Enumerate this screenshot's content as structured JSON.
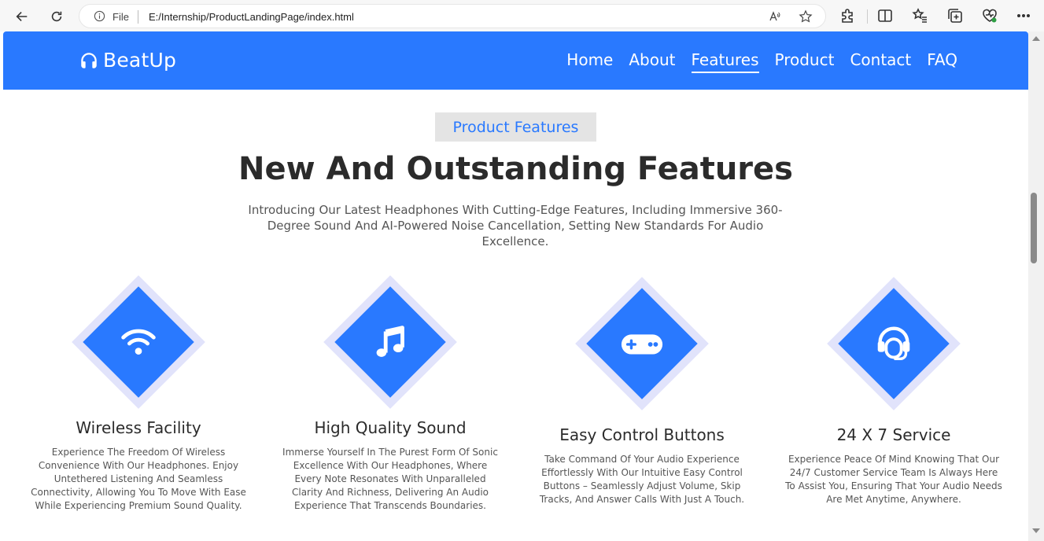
{
  "browser": {
    "file_label": "File",
    "url": "E:/Internship/ProductLandingPage/index.html"
  },
  "site": {
    "brand": "BeatUp",
    "nav": [
      {
        "label": "Home"
      },
      {
        "label": "About"
      },
      {
        "label": "Features",
        "active": true
      },
      {
        "label": "Product"
      },
      {
        "label": "Contact"
      },
      {
        "label": "FAQ"
      }
    ]
  },
  "section": {
    "tag": "Product Features",
    "heading": "New And Outstanding Features",
    "intro": "Introducing Our Latest Headphones With Cutting-Edge Features, Including Immersive 360-Degree Sound And AI-Powered Noise Cancellation, Setting New Standards For Audio Excellence."
  },
  "features": [
    {
      "icon": "wifi-icon",
      "title": "Wireless Facility",
      "text": "Experience The Freedom Of Wireless Convenience With Our Headphones. Enjoy Untethered Listening And Seamless Connectivity, Allowing You To Move With Ease While Experiencing Premium Sound Quality."
    },
    {
      "icon": "music-note-icon",
      "title": "High Quality Sound",
      "text": "Immerse Yourself In The Purest Form Of Sonic Excellence With Our Headphones, Where Every Note Resonates With Unparalleled Clarity And Richness, Delivering An Audio Experience That Transcends Boundaries."
    },
    {
      "icon": "gamepad-icon",
      "title": "Easy Control Buttons",
      "text": "Take Command Of Your Audio Experience Effortlessly With Our Intuitive Easy Control Buttons – Seamlessly Adjust Volume, Skip Tracks, And Answer Calls With Just A Touch."
    },
    {
      "icon": "headset-icon",
      "title": "24 X 7 Service",
      "text": "Experience Peace Of Mind Knowing That Our 24/7 Customer Service Team Is Always Here To Assist You, Ensuring That Your Audio Needs Are Met Anytime, Anywhere."
    }
  ],
  "colors": {
    "primary": "#2979ff",
    "diamond_halo": "#e1e3fb",
    "tag_bg": "#e4e4e4"
  }
}
